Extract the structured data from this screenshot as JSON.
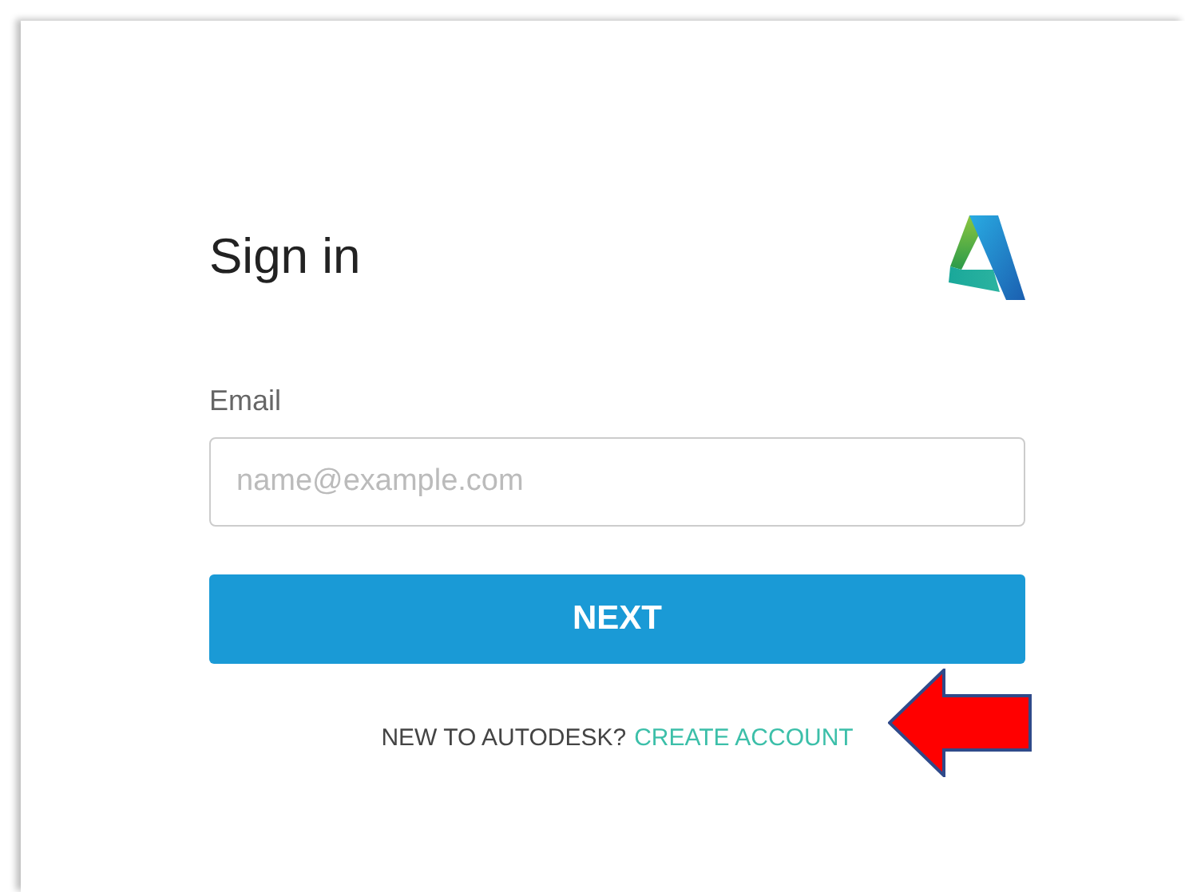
{
  "title": "Sign in",
  "email": {
    "label": "Email",
    "placeholder": "name@example.com"
  },
  "next_button": "NEXT",
  "footer": {
    "prompt": "NEW TO AUTODESK?",
    "link": "CREATE ACCOUNT"
  }
}
